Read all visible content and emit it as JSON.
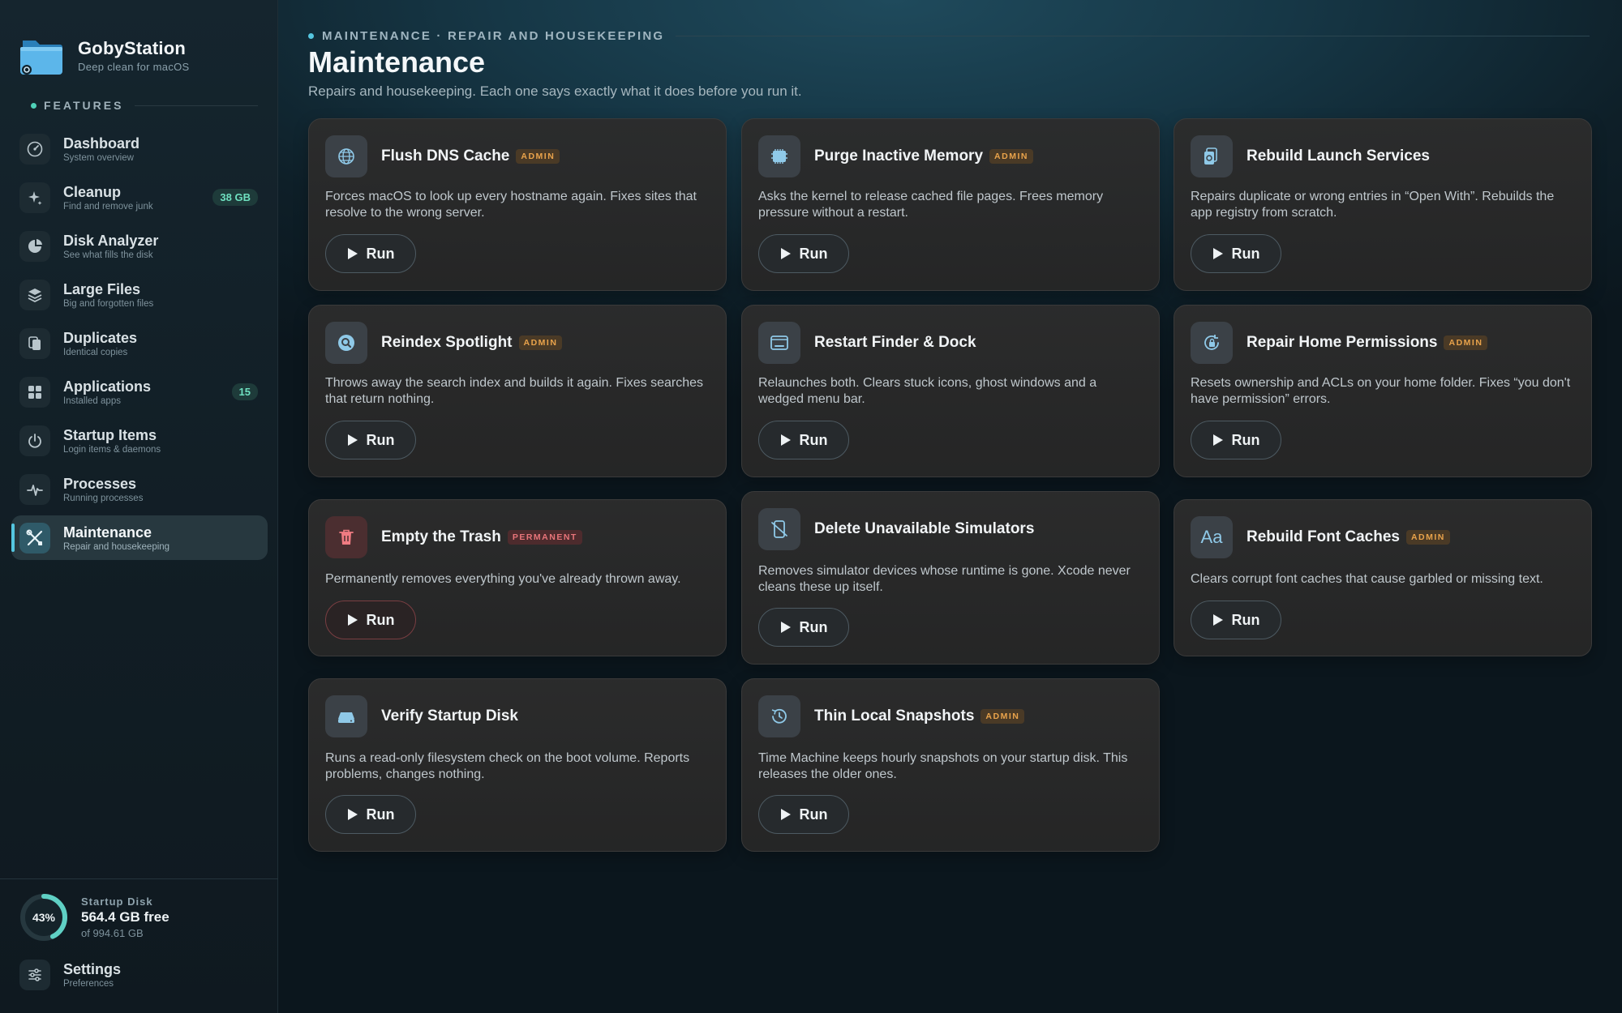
{
  "brand": {
    "name": "GobyStation",
    "tagline": "Deep clean for macOS"
  },
  "sidebar": {
    "section_label": "FEATURES",
    "items": [
      {
        "title": "Dashboard",
        "subtitle": "System overview",
        "icon": "dashboard-gauge-icon"
      },
      {
        "title": "Cleanup",
        "subtitle": "Find and remove junk",
        "badge": "38 GB",
        "icon": "sparkle-icon"
      },
      {
        "title": "Disk Analyzer",
        "subtitle": "See what fills the disk",
        "icon": "pie-chart-icon"
      },
      {
        "title": "Large Files",
        "subtitle": "Big and forgotten files",
        "icon": "stack-icon"
      },
      {
        "title": "Duplicates",
        "subtitle": "Identical copies",
        "icon": "copy-icon"
      },
      {
        "title": "Applications",
        "subtitle": "Installed apps",
        "badge": "15",
        "icon": "grid-icon"
      },
      {
        "title": "Startup Items",
        "subtitle": "Login items & daemons",
        "icon": "power-icon"
      },
      {
        "title": "Processes",
        "subtitle": "Running processes",
        "icon": "pulse-icon"
      },
      {
        "title": "Maintenance",
        "subtitle": "Repair and housekeeping",
        "icon": "tools-icon",
        "active": true
      }
    ],
    "disk": {
      "percent_label": "43%",
      "percent": 43,
      "label": "Startup Disk",
      "free": "564.4 GB free",
      "total": "of 994.61 GB"
    },
    "settings": {
      "title": "Settings",
      "subtitle": "Preferences"
    }
  },
  "header": {
    "breadcrumb": "MAINTENANCE · REPAIR AND HOUSEKEEPING",
    "title": "Maintenance",
    "subtitle": "Repairs and housekeeping. Each one says exactly what it does before you run it."
  },
  "run_label": "Run",
  "cards": [
    {
      "title": "Flush DNS Cache",
      "badge": "ADMIN",
      "desc": "Forces macOS to look up every hostname again. Fixes sites that resolve to the wrong server.",
      "icon": "globe-icon"
    },
    {
      "title": "Purge Inactive Memory",
      "badge": "ADMIN",
      "desc": "Asks the kernel to release cached file pages. Frees memory pressure without a restart.",
      "icon": "memory-chip-icon"
    },
    {
      "title": "Rebuild Launch Services",
      "badge": "",
      "desc": "Repairs duplicate or wrong entries in “Open With”. Rebuilds the app registry from scratch.",
      "icon": "documents-icon"
    },
    {
      "title": "Reindex Spotlight",
      "badge": "ADMIN",
      "desc": "Throws away the search index and builds it again. Fixes searches that return nothing.",
      "icon": "magnifier-icon"
    },
    {
      "title": "Restart Finder & Dock",
      "badge": "",
      "desc": "Relaunches both. Clears stuck icons, ghost windows and a wedged menu bar.",
      "icon": "window-icon"
    },
    {
      "title": "Repair Home Permissions",
      "badge": "ADMIN",
      "desc": "Resets ownership and ACLs on your home folder. Fixes “you don't have permission” errors.",
      "icon": "lock-rotate-icon"
    },
    {
      "title": "Empty the Trash",
      "badge": "PERMANENT",
      "desc": "Permanently removes everything you've already thrown away.",
      "icon": "trash-icon"
    },
    {
      "title": "Delete Unavailable Simulators",
      "badge": "",
      "desc": "Removes simulator devices whose runtime is gone. Xcode never cleans these up itself.",
      "icon": "phone-slash-icon"
    },
    {
      "title": "Rebuild Font Caches",
      "badge": "ADMIN",
      "desc": "Clears corrupt font caches that cause garbled or missing text.",
      "icon": "font-icon",
      "icon_text": "Aa"
    },
    {
      "title": "Verify Startup Disk",
      "badge": "",
      "desc": "Runs a read-only filesystem check on the boot volume. Reports problems, changes nothing.",
      "icon": "drive-icon"
    },
    {
      "title": "Thin Local Snapshots",
      "badge": "ADMIN",
      "desc": "Time Machine keeps hourly snapshots on your startup disk. This releases the older ones.",
      "icon": "history-icon"
    }
  ],
  "colors": {
    "accent": "#55c6e0",
    "admin_badge": "#e9a34b",
    "permanent_badge": "#e8757a",
    "count_badge": "#6fe0c0"
  }
}
